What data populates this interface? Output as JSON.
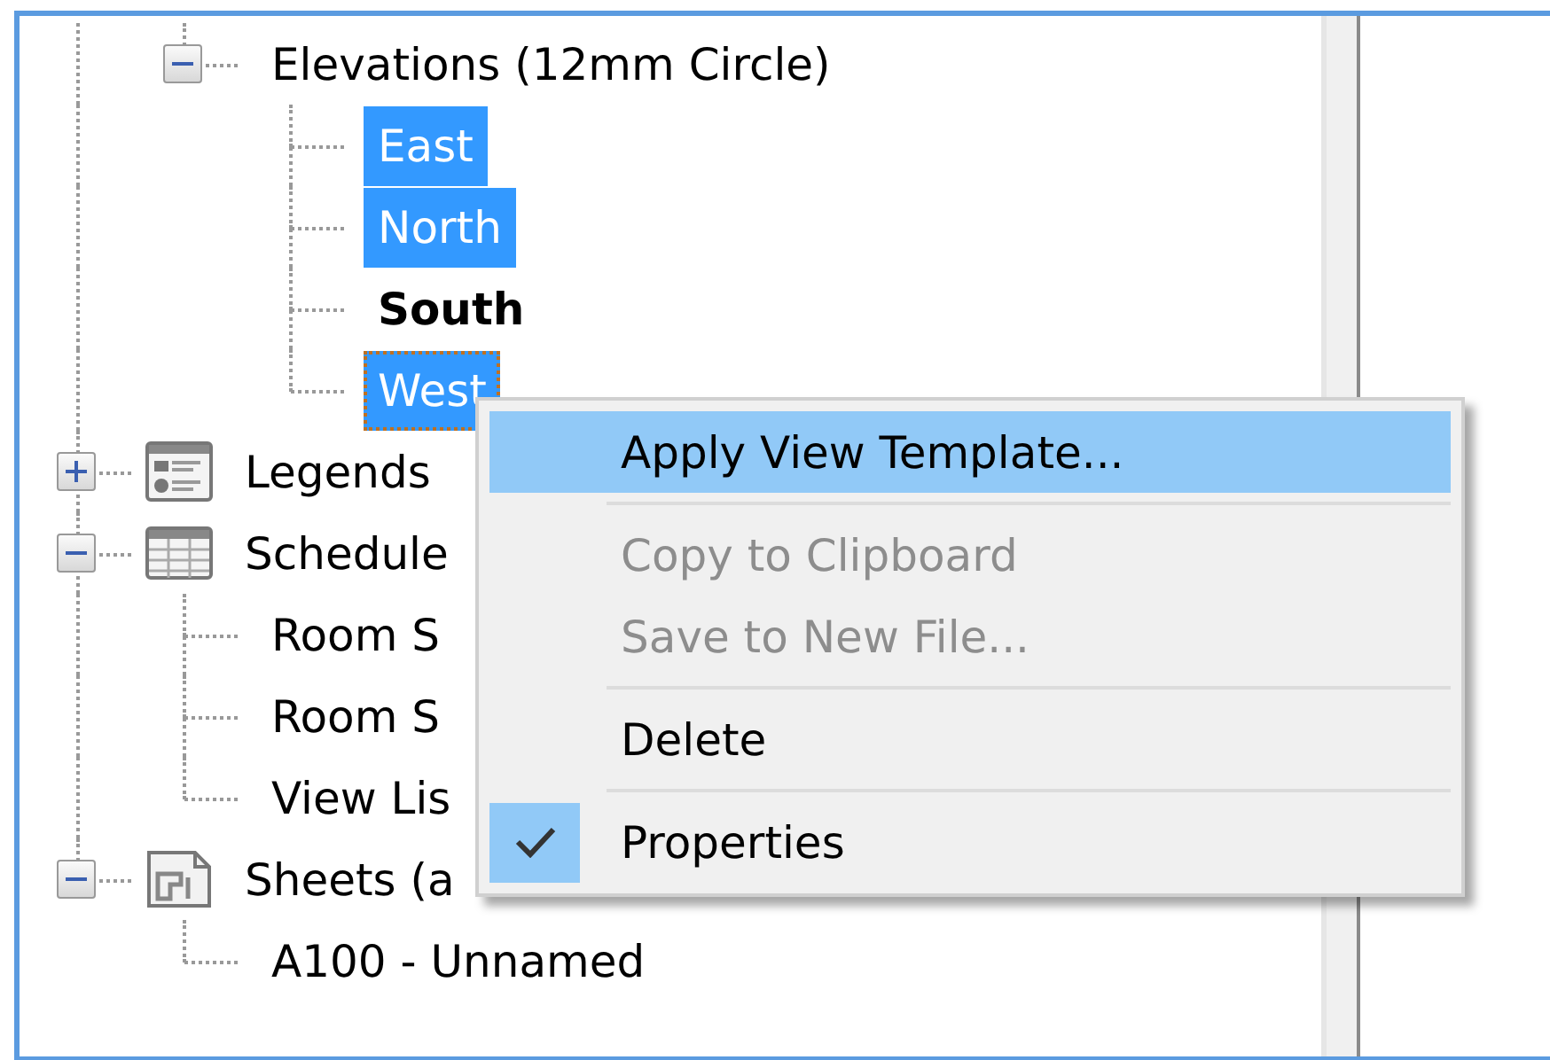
{
  "tree": {
    "items": [
      {
        "children": [
          {
            "label": "Elevations (12mm Circle)",
            "expanded": true,
            "selected": false,
            "current": false,
            "focused": false,
            "children": [
              {
                "label": "East",
                "selected": true,
                "current": false,
                "focused": false
              },
              {
                "label": "North",
                "selected": true,
                "current": false,
                "focused": false
              },
              {
                "label": "South",
                "selected": false,
                "current": true,
                "focused": false
              },
              {
                "label": "West",
                "selected": true,
                "current": false,
                "focused": true
              }
            ]
          }
        ]
      },
      {
        "label": "Legends",
        "kind": "legend",
        "expanded": false,
        "selected": false,
        "current": false,
        "focused": false
      },
      {
        "label": "Schedule",
        "kind": "schedule",
        "expanded": true,
        "selected": false,
        "current": false,
        "focused": false,
        "children": [
          {
            "label": "Room S",
            "selected": false,
            "current": false,
            "focused": false
          },
          {
            "label": "Room S",
            "selected": false,
            "current": false,
            "focused": false
          },
          {
            "label": "View Lis",
            "selected": false,
            "current": false,
            "focused": false
          }
        ]
      },
      {
        "label": "Sheets (a",
        "kind": "sheet",
        "expanded": true,
        "selected": false,
        "current": false,
        "focused": false,
        "children": [
          {
            "label": "A100 - Unnamed",
            "selected": false,
            "current": false,
            "focused": false
          }
        ]
      }
    ]
  },
  "context_menu": {
    "items": [
      {
        "kind": "item",
        "label": "Apply View Template...",
        "selected": true,
        "disabled": false,
        "checked": false
      },
      {
        "kind": "separator"
      },
      {
        "kind": "item",
        "label": "Copy to Clipboard",
        "selected": false,
        "disabled": true,
        "checked": false
      },
      {
        "kind": "item",
        "label": "Save to New File...",
        "selected": false,
        "disabled": true,
        "checked": false
      },
      {
        "kind": "separator"
      },
      {
        "kind": "item",
        "label": "Delete",
        "selected": false,
        "disabled": false,
        "checked": false
      },
      {
        "kind": "separator"
      },
      {
        "kind": "item",
        "label": "Properties",
        "selected": false,
        "disabled": false,
        "checked": true
      }
    ]
  }
}
